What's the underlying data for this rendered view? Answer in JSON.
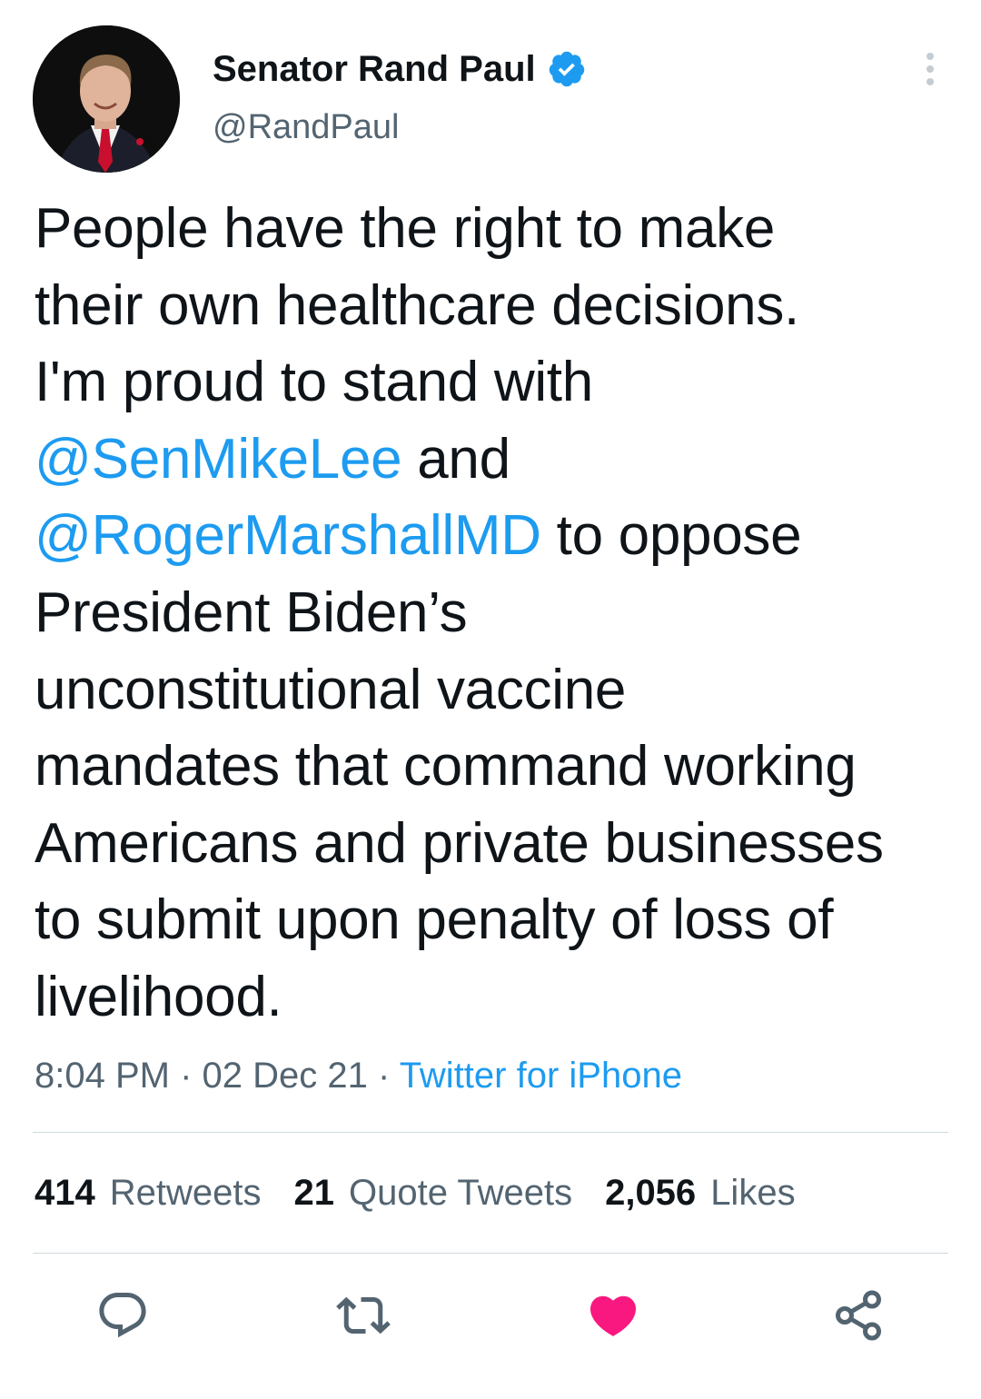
{
  "tweet": {
    "author": {
      "display_name": "Senator Rand Paul",
      "handle": "@RandPaul",
      "verified": true
    },
    "text_lines": [
      [
        {
          "text": "People have the right to make",
          "type": "text"
        }
      ],
      [
        {
          "text": "their own healthcare decisions.",
          "type": "text"
        }
      ],
      [
        {
          "text": "I'm proud to stand with",
          "type": "text"
        }
      ],
      [
        {
          "text": "@SenMikeLee",
          "type": "mention"
        },
        {
          "text": " and",
          "type": "text"
        }
      ],
      [
        {
          "text": "@RogerMarshallMD",
          "type": "mention"
        },
        {
          "text": " to oppose",
          "type": "text"
        }
      ],
      [
        {
          "text": "President Biden’s",
          "type": "text"
        }
      ],
      [
        {
          "text": "unconstitutional vaccine",
          "type": "text"
        }
      ],
      [
        {
          "text": "mandates that command working",
          "type": "text"
        }
      ],
      [
        {
          "text": "Americans and private businesses",
          "type": "text"
        }
      ],
      [
        {
          "text": "to submit upon penalty of loss of",
          "type": "text"
        }
      ],
      [
        {
          "text": "livelihood.",
          "type": "text"
        }
      ]
    ],
    "time": "8:04 PM",
    "separator": " · ",
    "date": "02 Dec 21",
    "source": "Twitter for iPhone",
    "stats": {
      "retweets_count": "414",
      "retweets_label": "Retweets",
      "quotes_count": "21",
      "quotes_label": "Quote Tweets",
      "likes_count": "2,056",
      "likes_label": "Likes"
    },
    "liked": true
  },
  "icons": {
    "verified": "verified-badge-icon",
    "more": "more-vertical-icon",
    "reply": "reply-icon",
    "retweet": "retweet-icon",
    "like": "heart-icon",
    "share": "share-icon"
  },
  "colors": {
    "accent": "#1d9bf0",
    "like": "#f91880",
    "text": "#0f1419",
    "secondary": "#536471",
    "divider": "#cfd9de"
  }
}
